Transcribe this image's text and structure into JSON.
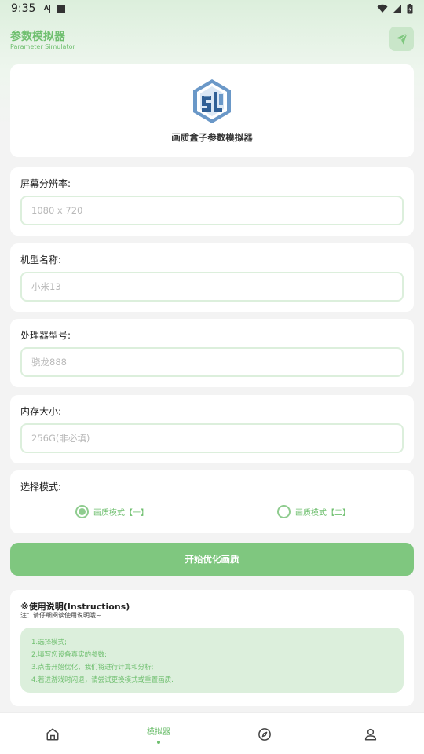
{
  "status_bar": {
    "time": "9:35",
    "notif_a": "A"
  },
  "header": {
    "title": "参数模拟器",
    "subtitle": "Parameter Simulator"
  },
  "logo_card": {
    "app_name": "画质盒子参数模拟器"
  },
  "fields": [
    {
      "label": "屏幕分辨率:",
      "placeholder": "1080 x 720"
    },
    {
      "label": "机型名称:",
      "placeholder": "小米13"
    },
    {
      "label": "处理器型号:",
      "placeholder": "骁龙888"
    },
    {
      "label": "内存大小:",
      "placeholder": "256G(非必填)"
    }
  ],
  "mode": {
    "label": "选择模式:",
    "options": [
      {
        "label": "画质模式【一】",
        "selected": true
      },
      {
        "label": "画质模式【二】",
        "selected": false
      }
    ]
  },
  "start_button": {
    "label": "开始优化画质"
  },
  "instructions": {
    "title": "※使用说明(Instructions)",
    "note": "注：请仔细阅读使用说明哦~",
    "lines": [
      "1.选择模式;",
      "2.填写您设备真实的参数;",
      "3.点击开始优化，我们将进行计算和分析;",
      "4.若进游戏时闪退，请尝试更换模式或重置画质."
    ]
  },
  "bottom_nav": {
    "items": [
      {
        "icon": "home-icon",
        "label": ""
      },
      {
        "icon": "",
        "label": "模拟器",
        "active": true
      },
      {
        "icon": "compass-icon",
        "label": ""
      },
      {
        "icon": "profile-icon",
        "label": ""
      }
    ]
  },
  "colors": {
    "accent": "#7fc77f",
    "accent_text": "#6fbf6f",
    "accent_light": "#dcefdc",
    "background": "#f3f3f3"
  }
}
